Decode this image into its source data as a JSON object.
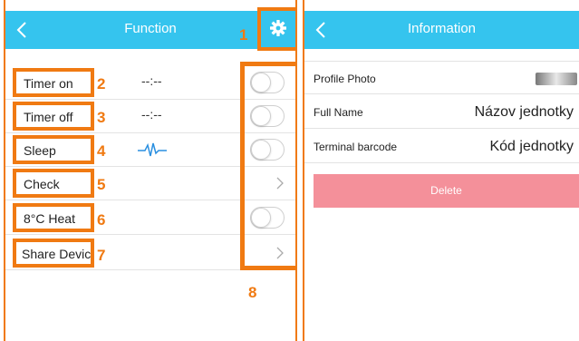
{
  "left": {
    "title": "Function",
    "rows": [
      {
        "label": "Timer on",
        "value": "--:--",
        "number": "2"
      },
      {
        "label": "Timer off",
        "value": "--:--",
        "number": "3"
      },
      {
        "label": "Sleep",
        "value": "",
        "number": "4"
      },
      {
        "label": "Check",
        "value": "",
        "number": "5"
      },
      {
        "label": "8°C Heat",
        "value": "",
        "number": "6"
      },
      {
        "label": "Share Devic",
        "value": "",
        "number": "7"
      }
    ],
    "gear_number": "1",
    "toggles_number": "8"
  },
  "right": {
    "title": "Information",
    "rows": [
      {
        "label": "Profile Photo",
        "value": ""
      },
      {
        "label": "Full Name",
        "value": "Názov jednotky"
      },
      {
        "label": "Terminal barcode",
        "value": "Kód jednotky"
      }
    ],
    "delete_label": "Delete"
  },
  "colors": {
    "header": "#35c4ee",
    "annotation": "#f07a12",
    "delete": "#f4909a"
  },
  "icons": [
    "back-icon",
    "gear-icon",
    "heartbeat-icon",
    "chevron-right-icon",
    "toggle-switch"
  ],
  "toggles": {
    "timer_on": false,
    "timer_off": false,
    "sleep": false,
    "heat": false
  }
}
